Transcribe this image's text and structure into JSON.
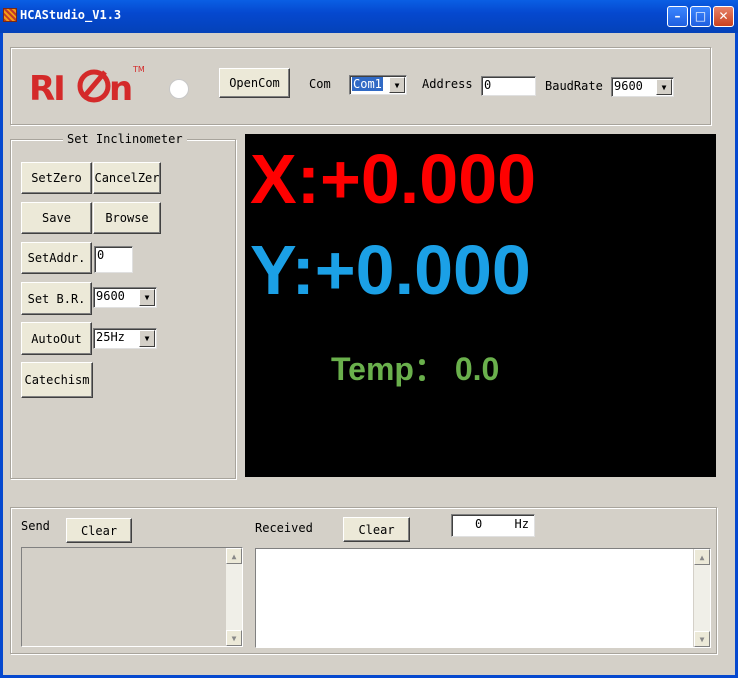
{
  "window": {
    "title": "HCAStudio_V1.3",
    "minimize_glyph": "–",
    "maximize_glyph": "□",
    "close_glyph": "✕"
  },
  "logo": {
    "text": "RION",
    "tm": "TM",
    "color": "#d42a2a"
  },
  "connection": {
    "open_com_label": "OpenCom",
    "com_label": "Com",
    "com_value": "Com1",
    "address_label": "Address",
    "address_value": "0",
    "baudrate_label": "BaudRate",
    "baudrate_value": "9600"
  },
  "set_panel": {
    "title": "Set Inclinometer",
    "set_zero_label": "SetZero",
    "cancel_zero_label": "CancelZer",
    "save_label": "Save",
    "browse_label": "Browse",
    "set_addr_label": "SetAddr.",
    "set_addr_value": "0",
    "set_br_label": "Set B.R.",
    "set_br_value": "9600",
    "auto_out_label": "AutoOut",
    "auto_out_value": "25Hz",
    "catechism_label": "Catechism"
  },
  "display": {
    "x_text": "X:+0.000",
    "y_text": "Y:+0.000",
    "temp_text": "Temp： 0.0",
    "x_color": "#ff0000",
    "y_color": "#1ba0e6",
    "temp_color": "#6ab04c"
  },
  "log": {
    "send_label": "Send",
    "send_clear_label": "Clear",
    "received_label": "Received",
    "received_clear_label": "Clear",
    "hz_value": "0",
    "hz_unit": "Hz"
  }
}
